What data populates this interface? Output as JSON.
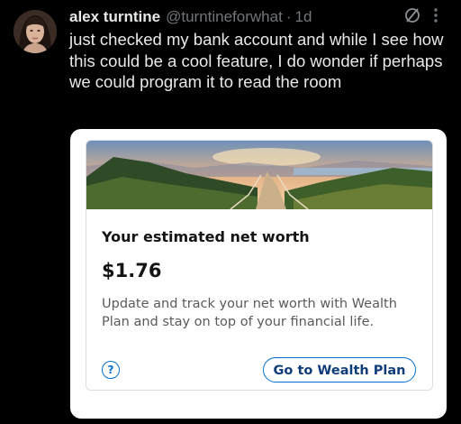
{
  "post": {
    "author_name": "alex turntine",
    "author_handle": "@turntineforwhat",
    "separator": "·",
    "timestamp": "1d",
    "text": "just checked my bank account and while I see how this could be a cool feature, I do wonder if perhaps we could program it to read the room"
  },
  "icons": {
    "avatar": "user-avatar",
    "grok": "grok-icon",
    "more": "more-options-icon",
    "help": "help-icon"
  },
  "attachment": {
    "net_worth_title": "Your estimated net worth",
    "net_worth_value": "$1.76",
    "description": "Update and track your net worth with Wealth Plan and stay on top of your financial life.",
    "help_glyph": "?",
    "cta_label": "Go to Wealth Plan"
  },
  "colors": {
    "background": "#000000",
    "primary_text": "#e7e9ea",
    "secondary_text": "#71767b",
    "accent_blue": "#0071ce"
  }
}
